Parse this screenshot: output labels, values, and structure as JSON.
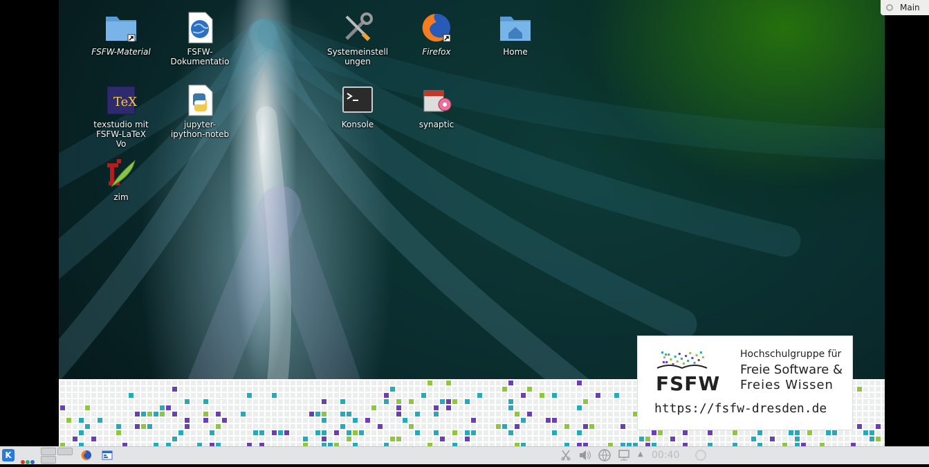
{
  "top_tab": {
    "label": "Main"
  },
  "desktop_icons": [
    {
      "label": "FSFW-Material",
      "italic": true
    },
    {
      "label": "FSFW-\nDokumentatio",
      "italic": false
    },
    {
      "label": "Systemeinstell\nungen",
      "italic": false
    },
    {
      "label": "Firefox",
      "italic": true
    },
    {
      "label": "Home",
      "italic": false
    },
    {
      "label": "texstudio mit\nFSFW-LaTeX Vo",
      "italic": false
    },
    {
      "label": "jupyter-\nipython-noteb",
      "italic": false
    },
    {
      "label": "Konsole",
      "italic": false
    },
    {
      "label": "synaptic",
      "italic": false
    },
    {
      "label": "zim",
      "italic": false
    }
  ],
  "fsfw_card": {
    "logo_text": "FSFW",
    "tagline_1": "Hochschulgruppe für",
    "tagline_2": "Freie Software &",
    "tagline_3": "Freies Wissen",
    "url": "https://fsfw-dresden.de"
  },
  "taskbar": {
    "clock": "00:40"
  },
  "colors": {
    "pattern_teal": "#2aa7b8",
    "pattern_green": "#8ec63f",
    "pattern_purple": "#6a3fb5",
    "taskbar_bg": "#e3e4e5"
  }
}
